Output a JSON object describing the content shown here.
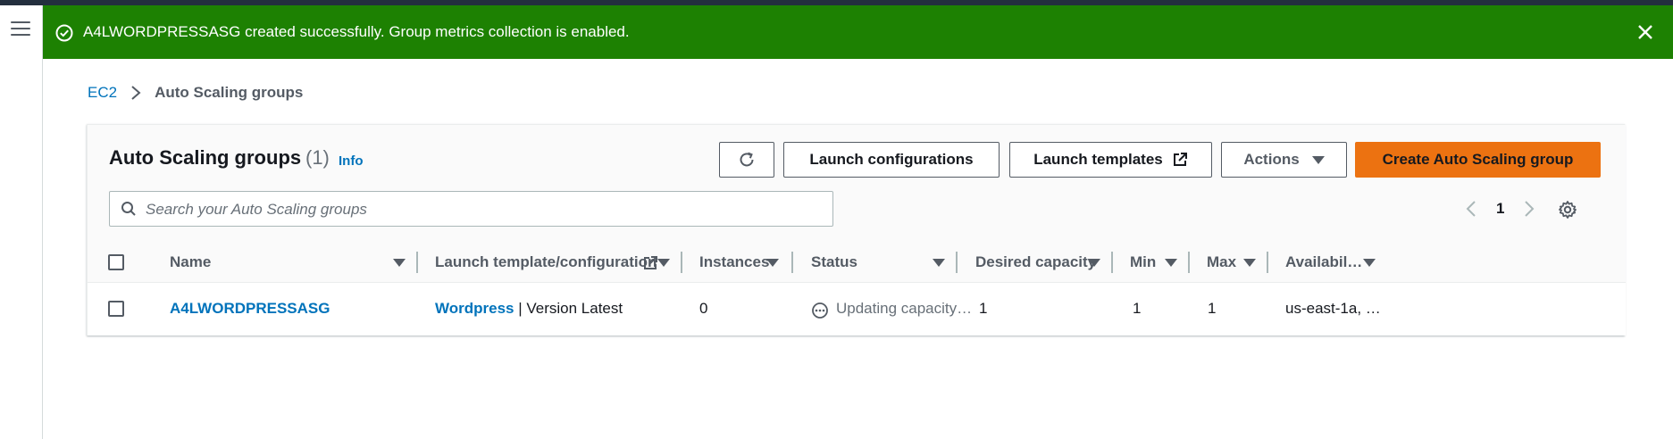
{
  "flash": {
    "message": "A4LWORDPRESSASG created successfully. Group metrics collection is enabled.",
    "type": "success"
  },
  "breadcrumb": {
    "root": "EC2",
    "current": "Auto Scaling groups"
  },
  "panel": {
    "title": "Auto Scaling groups",
    "count": "(1)",
    "info": "Info"
  },
  "buttons": {
    "launch_configurations": "Launch configurations",
    "launch_templates": "Launch templates",
    "actions": "Actions",
    "create": "Create Auto Scaling group"
  },
  "search": {
    "placeholder": "Search your Auto Scaling groups"
  },
  "pagination": {
    "current_page": "1"
  },
  "table": {
    "columns": {
      "name": "Name",
      "launch_template": "Launch template/configuration",
      "instances": "Instances",
      "status": "Status",
      "desired_capacity": "Desired capacity",
      "min": "Min",
      "max": "Max",
      "availability": "Availabil…"
    },
    "rows": [
      {
        "name": "A4LWORDPRESSASG",
        "launch_template_name": "Wordpress",
        "launch_template_version": " | Version Latest",
        "instances": "0",
        "status": "Updating capacity…",
        "desired_capacity": "1",
        "min": "1",
        "max": "1",
        "availability": "us-east-1a, …"
      }
    ]
  },
  "colors": {
    "success": "#1d8102",
    "primary_button": "#ec7211",
    "link": "#0073bb"
  }
}
